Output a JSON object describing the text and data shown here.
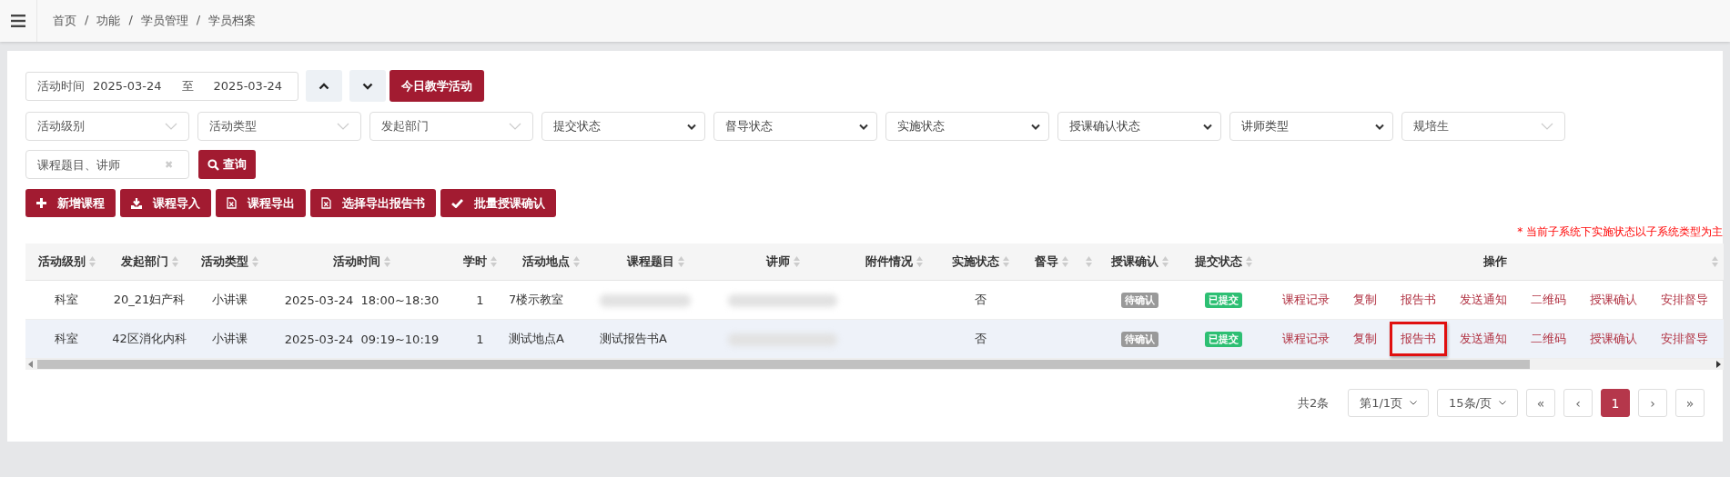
{
  "breadcrumb": {
    "items": [
      "首页",
      "功能",
      "学员管理",
      "学员档案"
    ],
    "separator": "/"
  },
  "date_range": {
    "label": "活动时间",
    "from": "2025-03-24",
    "to_label": "至",
    "to": "2025-03-24"
  },
  "nav_buttons": [
    {
      "kind": "up"
    },
    {
      "kind": "down"
    }
  ],
  "today_button": "今日教学活动",
  "filters": [
    {
      "placeholder": "活动级别",
      "kind": "chosen"
    },
    {
      "placeholder": "活动类型",
      "kind": "chosen"
    },
    {
      "placeholder": "发起部门",
      "kind": "chosen"
    },
    {
      "placeholder": "提交状态",
      "kind": "select"
    },
    {
      "placeholder": "督导状态",
      "kind": "select"
    },
    {
      "placeholder": "实施状态",
      "kind": "select"
    },
    {
      "placeholder": "授课确认状态",
      "kind": "select"
    },
    {
      "placeholder": "讲师类型",
      "kind": "select"
    },
    {
      "placeholder": "规培生",
      "kind": "chosen"
    }
  ],
  "search": {
    "placeholder": "课程题目、讲师",
    "clear": "✖",
    "button": "查询"
  },
  "actions": [
    {
      "label": "新增课程",
      "kind": "add"
    },
    {
      "label": "课程导入",
      "kind": "import"
    },
    {
      "label": "课程导出",
      "kind": "export"
    },
    {
      "label": "选择导出报告书",
      "kind": "export"
    },
    {
      "label": "批量授课确认",
      "kind": "confirm"
    }
  ],
  "notice": "* 当前子系统下实施状态以子系统类型为主",
  "table": {
    "columns": [
      "活动级别",
      "发起部门",
      "活动类型",
      "活动时间",
      "学时",
      "活动地点",
      "课程题目",
      "讲师",
      "附件情况",
      "实施状态",
      "督导",
      "",
      "授课确认",
      "提交状态",
      "操作"
    ],
    "rows": [
      {
        "level": "科室",
        "dept": "20_21妇产科",
        "type": "小讲课",
        "time": "2025-03-24  18:00~18:30",
        "hours": "1",
        "place": "7楼示教室",
        "title_blurred": true,
        "teacher_blurred": true,
        "done": "否",
        "confirm": {
          "label": "待确认",
          "color": "#999999"
        },
        "submit": {
          "label": "已提交",
          "color": "#2dbf73"
        },
        "ops": [
          {
            "label": "课程记录",
            "highlighted": false
          },
          {
            "label": "复制",
            "highlighted": false
          },
          {
            "label": "报告书",
            "highlighted": false
          },
          {
            "label": "发送通知",
            "highlighted": false
          },
          {
            "label": "二维码",
            "highlighted": false
          },
          {
            "label": "授课确认",
            "highlighted": false
          },
          {
            "label": "安排督导",
            "highlighted": false
          }
        ]
      },
      {
        "level": "科室",
        "dept": "42区消化内科",
        "type": "小讲课",
        "time": "2025-03-24  09:19~10:19",
        "hours": "1",
        "place": "测试地点A",
        "title": "测试报告书A",
        "title_blurred": false,
        "teacher_blurred": true,
        "done": "否",
        "confirm": {
          "label": "待确认",
          "color": "#999999"
        },
        "submit": {
          "label": "已提交",
          "color": "#2dbf73"
        },
        "ops": [
          {
            "label": "课程记录",
            "highlighted": false
          },
          {
            "label": "复制",
            "highlighted": false
          },
          {
            "label": "报告书",
            "highlighted": true
          },
          {
            "label": "发送通知",
            "highlighted": false
          },
          {
            "label": "二维码",
            "highlighted": false
          },
          {
            "label": "授课确认",
            "highlighted": false
          },
          {
            "label": "安排督导",
            "highlighted": false
          }
        ]
      }
    ]
  },
  "pagination": {
    "total": "共2条",
    "page_select": "第1/1页",
    "size_select": "15条/页",
    "pages": [
      {
        "label": "«",
        "selected": false
      },
      {
        "label": "‹",
        "selected": false
      },
      {
        "label": "1",
        "selected": true
      },
      {
        "label": "›",
        "selected": false
      },
      {
        "label": "»",
        "selected": false
      }
    ]
  }
}
